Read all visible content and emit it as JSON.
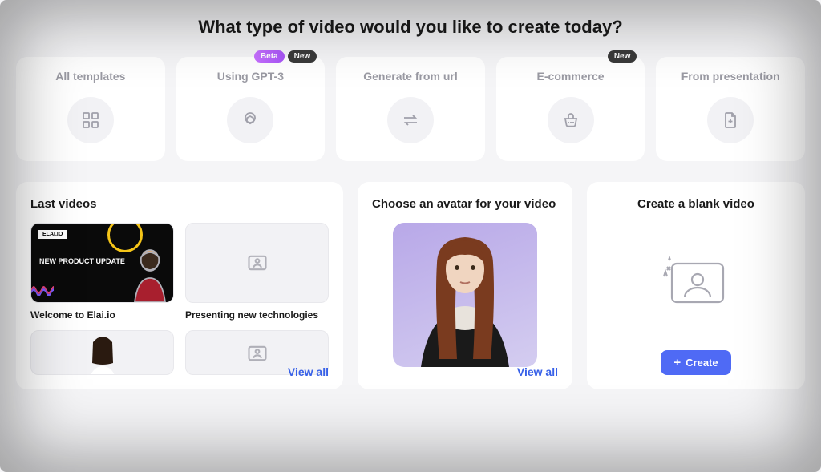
{
  "heading": "What type of video would you like to create today?",
  "categories": [
    {
      "key": "all-templates",
      "title": "All templates",
      "icon": "grid",
      "badges": []
    },
    {
      "key": "gpt3",
      "title": "Using GPT-3",
      "icon": "openai",
      "badges": [
        "Beta",
        "New"
      ]
    },
    {
      "key": "from-url",
      "title": "Generate from url",
      "icon": "swap",
      "badges": []
    },
    {
      "key": "ecommerce",
      "title": "E-commerce",
      "icon": "basket",
      "badges": [
        "New"
      ]
    },
    {
      "key": "presentation",
      "title": "From presentation",
      "icon": "file-plus",
      "badges": []
    }
  ],
  "panels": {
    "last_videos": {
      "title": "Last videos",
      "view_all": "View all",
      "items": [
        {
          "label": "Welcome to Elai.io",
          "thumb_type": "elai",
          "thumb_text": {
            "tag": "ELAI.IO",
            "headline": "NEW PRODUCT UPDATE"
          }
        },
        {
          "label": "Presenting new technologies",
          "thumb_type": "placeholder"
        }
      ]
    },
    "avatar": {
      "title": "Choose an avatar for your video",
      "view_all": "View all"
    },
    "blank": {
      "title": "Create a blank video",
      "button_label": "Create"
    }
  }
}
